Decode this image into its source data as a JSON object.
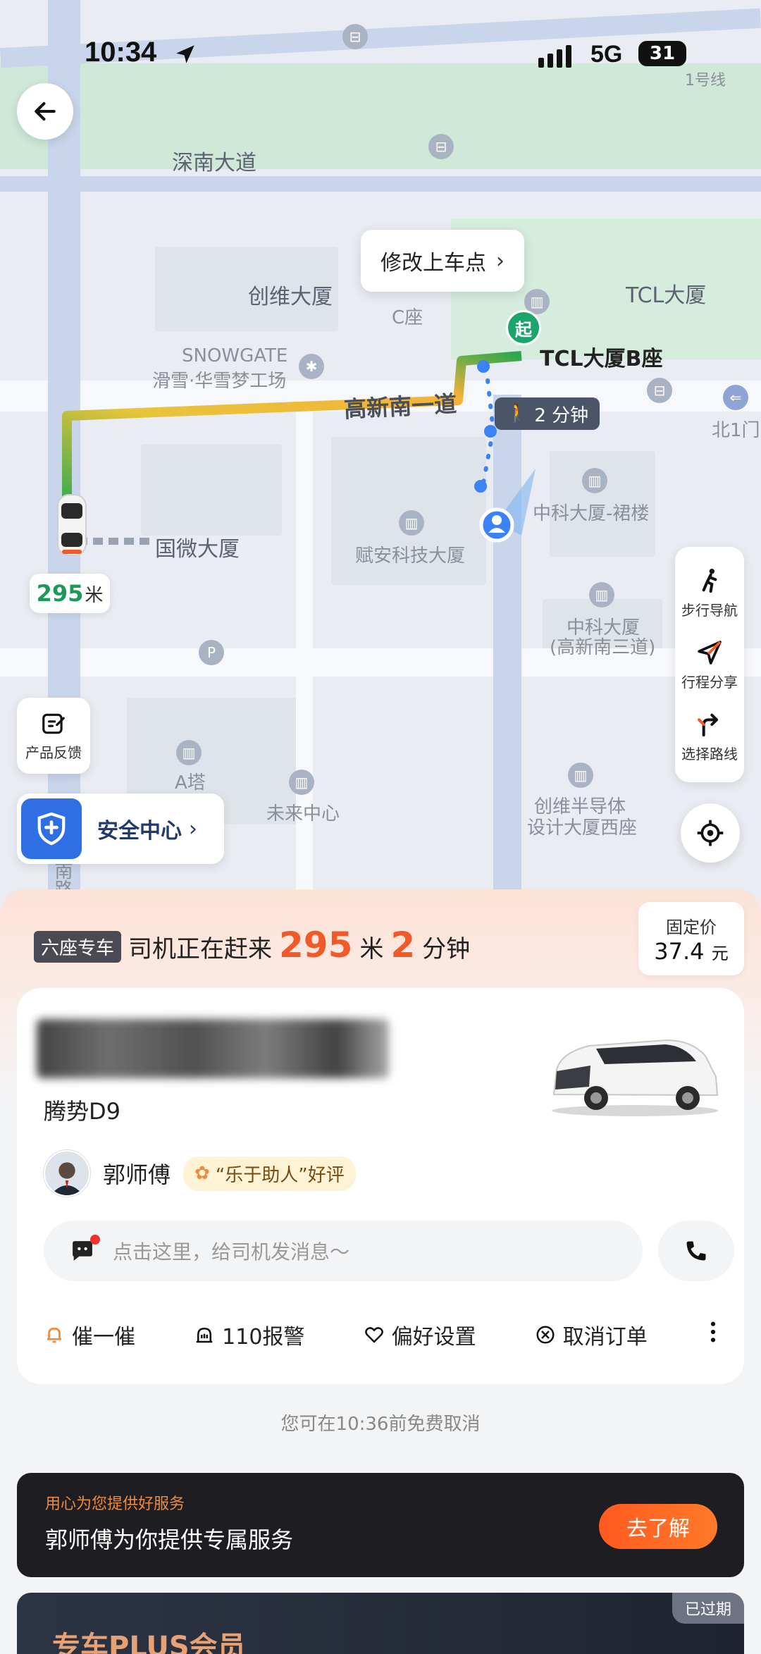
{
  "status_bar": {
    "time": "10:34",
    "network": "5G",
    "battery": "31"
  },
  "map": {
    "labels": {
      "metro": "1号线",
      "road_shennan": "深南大道",
      "chuangwei": "创维大厦",
      "c_block": "C座",
      "tcl": "TCL大厦",
      "snowgate": "SNOWGATE",
      "snowgate_cn": "滑雪·华雪梦工场",
      "road_gaoxin": "高新南一道",
      "north_gate": "北1门",
      "guowei": "国微大厦",
      "fuan": "赋安科技大厦",
      "zhongke_podium": "中科大厦-裙楼",
      "zhongke": "中科大厦",
      "zhongke_road": "(高新南三道)",
      "a_tower": "A塔",
      "weilai": "未来中心",
      "chuangwei_semi_1": "创维半导体",
      "chuangwei_semi_2": "设计大厦西座",
      "south_road": "南路"
    },
    "pickup_bubble": "修改上车点",
    "start_marker": "起",
    "pickup_place": "TCL大厦B座",
    "walk_time": "2 分钟",
    "driver_distance_value": "295",
    "driver_distance_unit": "米",
    "tools": [
      {
        "label": "步行导航",
        "icon": "walking-icon"
      },
      {
        "label": "行程分享",
        "icon": "share-trip-icon"
      },
      {
        "label": "选择路线",
        "icon": "route-icon"
      }
    ],
    "feedback_label": "产品反馈",
    "safety_label": "安全中心"
  },
  "sheet": {
    "car_type_badge": "六座专车",
    "status_prefix": "司机正在赶来",
    "distance_value": "295",
    "distance_unit": "米",
    "eta_value": "2",
    "eta_unit": "分钟",
    "price_label": "固定价",
    "price_value": "37.4",
    "price_unit": "元",
    "car_model": "腾势D9",
    "driver_name": "郭师傅",
    "praise": "“乐于助人”好评",
    "message_placeholder": "点击这里，给司机发消息～",
    "actions": [
      {
        "label": "催一催",
        "icon": "bell-icon"
      },
      {
        "label": "110报警",
        "icon": "alarm-icon"
      },
      {
        "label": "偏好设置",
        "icon": "heart-icon"
      },
      {
        "label": "取消订单",
        "icon": "cancel-icon"
      }
    ],
    "cancel_note": "您可在10:36前免费取消",
    "service_sub": "用心为您提供好服务",
    "service_title": "郭师傅为你提供专属服务",
    "service_button": "去了解",
    "plus_title": "专车PLUS会员",
    "plus_badge": "已过期"
  },
  "colors": {
    "accent_orange": "#f05a28",
    "route_green": "#1a9a56",
    "safety_blue": "#2f6fe4"
  }
}
